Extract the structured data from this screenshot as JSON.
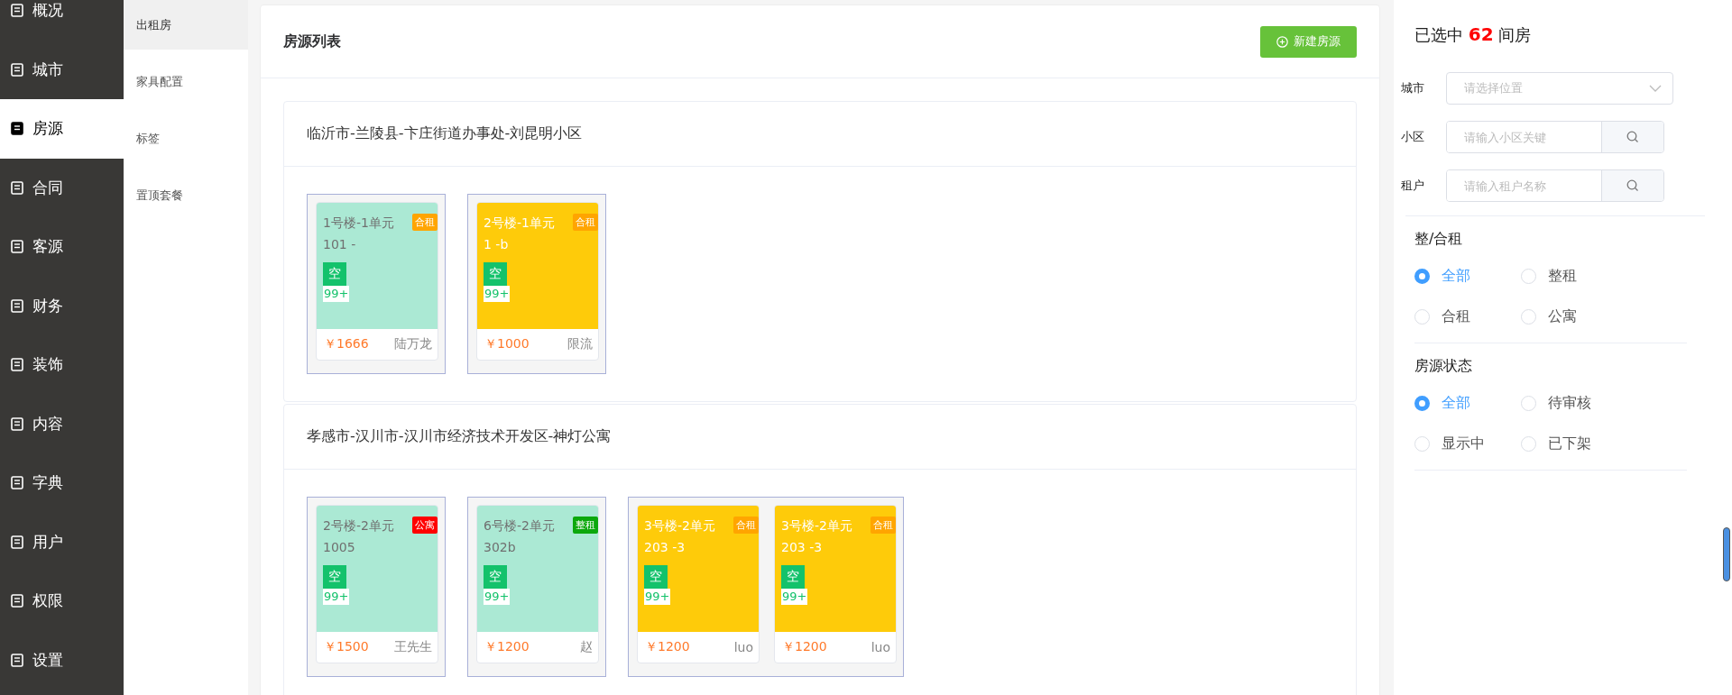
{
  "nav": {
    "items": [
      {
        "label": "概况",
        "selected": false
      },
      {
        "label": "城市",
        "selected": false
      },
      {
        "label": "房源",
        "selected": true
      },
      {
        "label": "合同",
        "selected": false
      },
      {
        "label": "客源",
        "selected": false
      },
      {
        "label": "财务",
        "selected": false
      },
      {
        "label": "装饰",
        "selected": false
      },
      {
        "label": "内容",
        "selected": false
      },
      {
        "label": "字典",
        "selected": false
      },
      {
        "label": "用户",
        "selected": false
      },
      {
        "label": "权限",
        "selected": false
      },
      {
        "label": "设置",
        "selected": false
      }
    ]
  },
  "subnav": {
    "items": [
      {
        "label": "出租房",
        "selected": true
      },
      {
        "label": "家具配置",
        "selected": false
      },
      {
        "label": "标签",
        "selected": false
      },
      {
        "label": "置顶套餐",
        "selected": false
      }
    ]
  },
  "list": {
    "title": "房源列表",
    "new_button": "新建房源",
    "groups": [
      {
        "address": "临沂市-兰陵县-卞庄街道办事处-刘昆明小区",
        "units": [
          {
            "rooms": [
              {
                "building": "1号楼-1单元",
                "room": "101 -",
                "tag": {
                  "label": "合租",
                  "kind": "shared"
                },
                "status": "空",
                "count": "99+",
                "price": "￥1666",
                "tenant": "陆万龙",
                "color": "#abe9d4"
              }
            ]
          },
          {
            "rooms": [
              {
                "building": "2号楼-1单元",
                "room": "1 -b",
                "tag": {
                  "label": "合租",
                  "kind": "shared"
                },
                "status": "空",
                "count": "99+",
                "price": "￥1000",
                "tenant": "限流",
                "color": "#fecb0a"
              }
            ]
          }
        ]
      },
      {
        "address": "孝感市-汉川市-汉川市经济技术开发区-神灯公寓",
        "units": [
          {
            "rooms": [
              {
                "building": "2号楼-2单元",
                "room": "1005",
                "tag": {
                  "label": "公寓",
                  "kind": "apartment"
                },
                "status": "空",
                "count": "99+",
                "price": "￥1500",
                "tenant": "王先生",
                "color": "#abe9d4"
              }
            ]
          },
          {
            "rooms": [
              {
                "building": "6号楼-2单元",
                "room": "302b",
                "tag": {
                  "label": "整租",
                  "kind": "whole"
                },
                "status": "空",
                "count": "99+",
                "price": "￥1200",
                "tenant": "赵",
                "color": "#abe9d4"
              }
            ]
          },
          {
            "rooms": [
              {
                "building": "3号楼-2单元",
                "room": "203 -3",
                "tag": {
                  "label": "合租",
                  "kind": "shared"
                },
                "status": "空",
                "count": "99+",
                "price": "￥1200",
                "tenant": "luo",
                "color": "#fecb0a"
              },
              {
                "building": "3号楼-2单元",
                "room": "203 -3",
                "tag": {
                  "label": "合租",
                  "kind": "shared"
                },
                "status": "空",
                "count": "99+",
                "price": "￥1200",
                "tenant": "luo",
                "color": "#fecb0a"
              }
            ]
          }
        ]
      }
    ]
  },
  "filters": {
    "headline": "已选中 **62** 间房",
    "fields": [
      {
        "kind": "select",
        "label": "城市",
        "placeholder": "请选择位置"
      },
      {
        "kind": "search",
        "label": "小区",
        "placeholder": "请输入小区关键"
      },
      {
        "kind": "search",
        "label": "租户",
        "placeholder": "请输入租户名称"
      }
    ],
    "radio_groups": [
      {
        "title": "整/合租",
        "options": [
          {
            "label": "全部",
            "selected": true
          },
          {
            "label": "整租",
            "selected": false
          },
          {
            "label": "合租",
            "selected": false
          },
          {
            "label": "公寓",
            "selected": false
          }
        ]
      },
      {
        "title": "房源状态",
        "options": [
          {
            "label": "全部",
            "selected": true
          },
          {
            "label": "待审核",
            "selected": false
          },
          {
            "label": "显示中",
            "selected": false
          },
          {
            "label": "已下架",
            "selected": false
          }
        ]
      }
    ]
  }
}
